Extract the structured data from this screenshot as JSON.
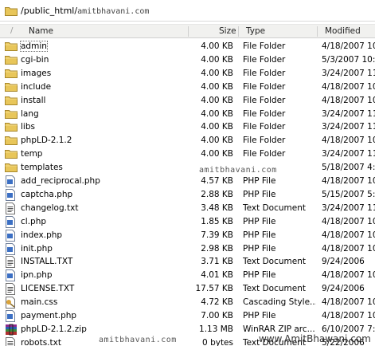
{
  "path": {
    "text": "/public_html/",
    "suffix": "amitbhavani.com"
  },
  "columns": {
    "name": "Name",
    "size": "Size",
    "type": "Type",
    "modified": "Modified"
  },
  "rows": [
    {
      "name": "admin",
      "size": "4.00 KB",
      "type": "File Folder",
      "modified": "4/18/2007 10",
      "icon": "folder-icon"
    },
    {
      "name": "cgi-bin",
      "size": "4.00 KB",
      "type": "File Folder",
      "modified": "5/3/2007 10::",
      "icon": "folder-icon"
    },
    {
      "name": "images",
      "size": "4.00 KB",
      "type": "File Folder",
      "modified": "3/24/2007 11",
      "icon": "folder-icon"
    },
    {
      "name": "include",
      "size": "4.00 KB",
      "type": "File Folder",
      "modified": "4/18/2007 10",
      "icon": "folder-icon"
    },
    {
      "name": "install",
      "size": "4.00 KB",
      "type": "File Folder",
      "modified": "4/18/2007 10",
      "icon": "folder-icon"
    },
    {
      "name": "lang",
      "size": "4.00 KB",
      "type": "File Folder",
      "modified": "3/24/2007 11",
      "icon": "folder-icon"
    },
    {
      "name": "libs",
      "size": "4.00 KB",
      "type": "File Folder",
      "modified": "3/24/2007 11",
      "icon": "folder-icon"
    },
    {
      "name": "phpLD-2.1.2",
      "size": "4.00 KB",
      "type": "File Folder",
      "modified": "4/18/2007 10",
      "icon": "folder-icon"
    },
    {
      "name": "temp",
      "size": "4.00 KB",
      "type": "File Folder",
      "modified": "3/24/2007 11",
      "icon": "folder-icon"
    },
    {
      "name": "templates",
      "size": "",
      "type": "",
      "modified": "5/18/2007 4:4",
      "icon": "folder-icon"
    },
    {
      "name": "add_reciprocal.php",
      "size": "4.57 KB",
      "type": "PHP File",
      "modified": "4/18/2007 10",
      "icon": "php-file-icon"
    },
    {
      "name": "captcha.php",
      "size": "2.88 KB",
      "type": "PHP File",
      "modified": "5/15/2007 5:0",
      "icon": "php-file-icon"
    },
    {
      "name": "changelog.txt",
      "size": "3.48 KB",
      "type": "Text Document",
      "modified": "3/24/2007 11",
      "icon": "text-file-icon"
    },
    {
      "name": "cl.php",
      "size": "1.85 KB",
      "type": "PHP File",
      "modified": "4/18/2007 10",
      "icon": "php-file-icon"
    },
    {
      "name": "index.php",
      "size": "7.39 KB",
      "type": "PHP File",
      "modified": "4/18/2007 10",
      "icon": "php-file-icon"
    },
    {
      "name": "init.php",
      "size": "2.98 KB",
      "type": "PHP File",
      "modified": "4/18/2007 10",
      "icon": "php-file-icon"
    },
    {
      "name": "INSTALL.TXT",
      "size": "3.71 KB",
      "type": "Text Document",
      "modified": "9/24/2006",
      "icon": "text-file-icon"
    },
    {
      "name": "ipn.php",
      "size": "4.01 KB",
      "type": "PHP File",
      "modified": "4/18/2007 10",
      "icon": "php-file-icon"
    },
    {
      "name": "LICENSE.TXT",
      "size": "17.57 KB",
      "type": "Text Document",
      "modified": "9/24/2006",
      "icon": "text-file-icon"
    },
    {
      "name": "main.css",
      "size": "4.72 KB",
      "type": "Cascading Style...",
      "modified": "4/18/2007 10",
      "icon": "css-file-icon"
    },
    {
      "name": "payment.php",
      "size": "7.00 KB",
      "type": "PHP File",
      "modified": "4/18/2007 10",
      "icon": "php-file-icon"
    },
    {
      "name": "phpLD-2.1.2.zip",
      "size": "1.13 MB",
      "type": "WinRAR ZIP arc...",
      "modified": "6/10/2007 7:2",
      "icon": "zip-archive-icon"
    },
    {
      "name": "robots.txt",
      "size": "0 bytes",
      "type": "Text Document",
      "modified": "5/22/2006",
      "icon": "text-file-icon"
    }
  ],
  "watermarks": {
    "mid": "amitbhavani.com",
    "bottom": "amitbhavani.com",
    "corner": "www.AmitBhawani.com"
  },
  "colors": {
    "folder": "#e8c65a",
    "header_bg": "#f1f1ef",
    "php_blue": "#3b6fc4"
  }
}
